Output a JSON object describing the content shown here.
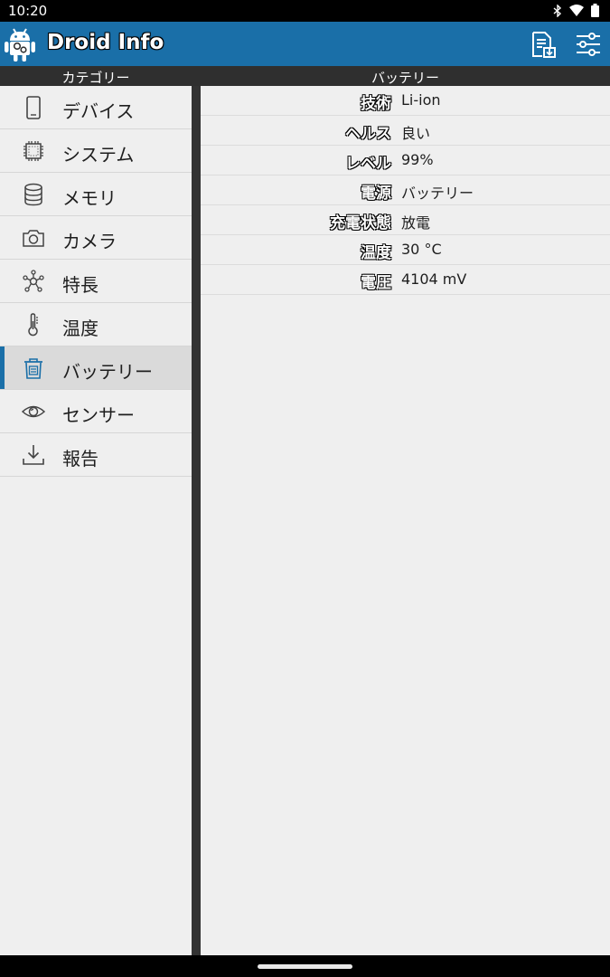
{
  "status": {
    "time": "10:20"
  },
  "app": {
    "title": "Droid Info"
  },
  "headers": {
    "left": "カテゴリー",
    "right": "バッテリー"
  },
  "sidebar": {
    "items": [
      {
        "label": "デバイス",
        "icon": "phone-icon"
      },
      {
        "label": "システム",
        "icon": "chip-icon"
      },
      {
        "label": "メモリ",
        "icon": "database-icon"
      },
      {
        "label": "カメラ",
        "icon": "camera-icon"
      },
      {
        "label": "特長",
        "icon": "network-icon"
      },
      {
        "label": "温度",
        "icon": "thermometer-icon"
      },
      {
        "label": "バッテリー",
        "icon": "battery-icon",
        "active": true
      },
      {
        "label": "センサー",
        "icon": "eye-icon"
      },
      {
        "label": "報告",
        "icon": "download-icon"
      }
    ]
  },
  "battery": {
    "rows": [
      {
        "key": "技術",
        "value": "Li-ion"
      },
      {
        "key": "ヘルス",
        "value": "良い"
      },
      {
        "key": "レベル",
        "value": "99%"
      },
      {
        "key": "電源",
        "value": "バッテリー"
      },
      {
        "key": "充電状態",
        "value": "放電"
      },
      {
        "key": "温度",
        "value": "30 °C"
      },
      {
        "key": "電圧",
        "value": "4104 mV"
      }
    ]
  },
  "colors": {
    "accent": "#1a6fa8",
    "header": "#2f2f2f"
  }
}
